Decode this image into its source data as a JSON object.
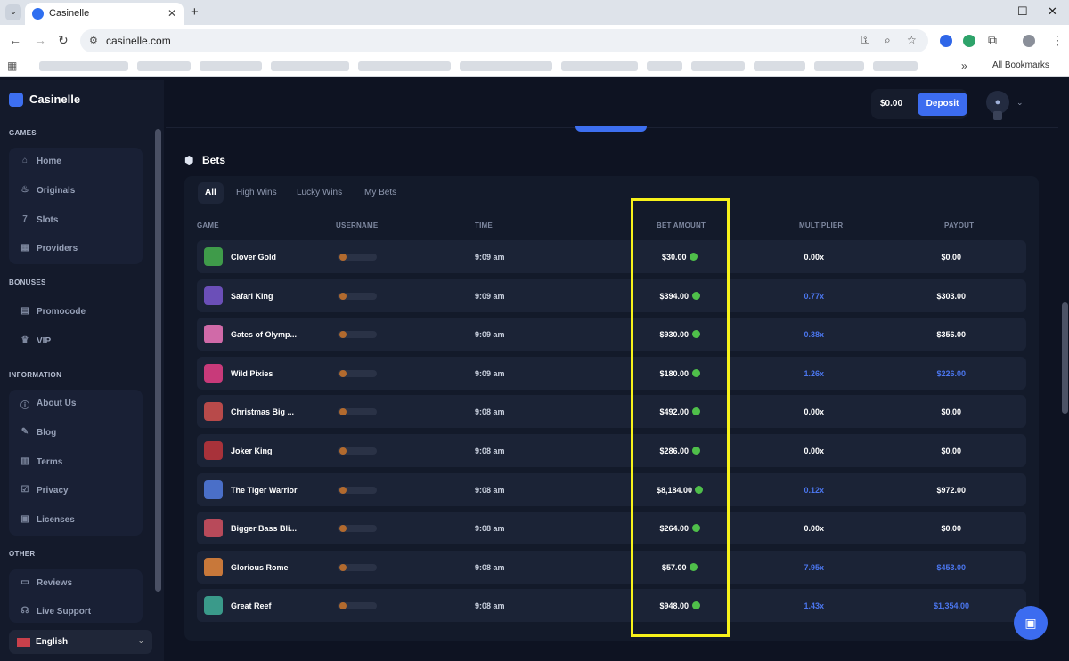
{
  "browser": {
    "tab_title": "Casinelle",
    "url": "casinelle.com",
    "all_bookmarks_label": "All Bookmarks",
    "window_controls": [
      "minimize-icon",
      "maximize-icon",
      "close-icon"
    ]
  },
  "sidebar": {
    "brand": "Casinelle",
    "sections": [
      {
        "title": "GAMES",
        "items": [
          {
            "label": "Home",
            "icon": "home-icon"
          },
          {
            "label": "Originals",
            "icon": "flame-icon"
          },
          {
            "label": "Slots",
            "icon": "slots-icon"
          },
          {
            "label": "Providers",
            "icon": "grid-icon"
          }
        ]
      },
      {
        "title": "BONUSES",
        "items": [
          {
            "label": "Promocode",
            "icon": "ticket-icon"
          },
          {
            "label": "VIP",
            "icon": "crown-icon"
          }
        ]
      },
      {
        "title": "INFORMATION",
        "items": [
          {
            "label": "About Us",
            "icon": "info-icon"
          },
          {
            "label": "Blog",
            "icon": "blog-icon"
          },
          {
            "label": "Terms",
            "icon": "document-icon"
          },
          {
            "label": "Privacy",
            "icon": "shield-check-icon"
          },
          {
            "label": "Licenses",
            "icon": "license-icon"
          }
        ]
      },
      {
        "title": "OTHER",
        "items": [
          {
            "label": "Reviews",
            "icon": "comment-icon"
          },
          {
            "label": "Live Support",
            "icon": "headset-icon"
          }
        ]
      }
    ],
    "language": "English"
  },
  "header": {
    "balance": "$0.00",
    "deposit_label": "Deposit"
  },
  "bets": {
    "title": "Bets",
    "tabs": [
      "All",
      "High Wins",
      "Lucky Wins",
      "My Bets"
    ],
    "active_tab": "All",
    "columns": [
      "GAME",
      "USERNAME",
      "TIME",
      "BET AMOUNT",
      "MULTIPLIER",
      "PAYOUT"
    ],
    "rows": [
      {
        "game": "Clover Gold",
        "time": "9:09 am",
        "bet": "$30.00",
        "multiplier": "0.00x",
        "payout": "$0.00",
        "win": false,
        "thumb": "#3f9b4a"
      },
      {
        "game": "Safari King",
        "time": "9:09 am",
        "bet": "$394.00",
        "multiplier": "0.77x",
        "payout": "$303.00",
        "win": false,
        "mult_blue": true,
        "thumb": "#6b4fb8"
      },
      {
        "game": "Gates of Olymp...",
        "time": "9:09 am",
        "bet": "$930.00",
        "multiplier": "0.38x",
        "payout": "$356.00",
        "win": false,
        "mult_blue": true,
        "thumb": "#d06aa8"
      },
      {
        "game": "Wild Pixies",
        "time": "9:09 am",
        "bet": "$180.00",
        "multiplier": "1.26x",
        "payout": "$226.00",
        "win": true,
        "mult_blue": true,
        "thumb": "#c83a7a"
      },
      {
        "game": "Christmas Big ...",
        "time": "9:08 am",
        "bet": "$492.00",
        "multiplier": "0.00x",
        "payout": "$0.00",
        "win": false,
        "thumb": "#b84a4a"
      },
      {
        "game": "Joker King",
        "time": "9:08 am",
        "bet": "$286.00",
        "multiplier": "0.00x",
        "payout": "$0.00",
        "win": false,
        "thumb": "#a8323a"
      },
      {
        "game": "The Tiger Warrior",
        "time": "9:08 am",
        "bet": "$8,184.00",
        "multiplier": "0.12x",
        "payout": "$972.00",
        "win": false,
        "mult_blue": true,
        "thumb": "#4a6fc8"
      },
      {
        "game": "Bigger Bass Bli...",
        "time": "9:08 am",
        "bet": "$264.00",
        "multiplier": "0.00x",
        "payout": "$0.00",
        "win": false,
        "thumb": "#b84a5a"
      },
      {
        "game": "Glorious Rome",
        "time": "9:08 am",
        "bet": "$57.00",
        "multiplier": "7.95x",
        "payout": "$453.00",
        "win": true,
        "mult_blue": true,
        "thumb": "#c8783a"
      },
      {
        "game": "Great Reef",
        "time": "9:08 am",
        "bet": "$948.00",
        "multiplier": "1.43x",
        "payout": "$1,354.00",
        "win": true,
        "mult_blue": true,
        "thumb": "#3a9a8a"
      }
    ]
  },
  "colors": {
    "accent": "#3c6cf0",
    "highlight": "#f7f21a",
    "coin": "#4fbf4a",
    "win_text": "#4b76ee"
  }
}
